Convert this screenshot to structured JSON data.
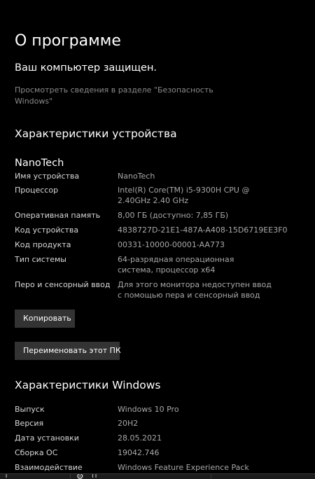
{
  "header": {
    "title": "О программе"
  },
  "status": {
    "protected": "Ваш компьютер защищен.",
    "security_link": "Просмотреть сведения в разделе \"Безопасность Windows\""
  },
  "device_section": {
    "heading": "Характеристики устройства",
    "device_name": "NanoTech",
    "rows": [
      {
        "label": "Имя устройства",
        "value": "NanoTech"
      },
      {
        "label": "Процессор",
        "value": "Intel(R) Core(TM) i5-9300H CPU @ 2.40GHz   2.40 GHz"
      },
      {
        "label": "Оперативная память",
        "value": "8,00 ГБ (доступно: 7,85 ГБ)"
      },
      {
        "label": "Код устройства",
        "value": "4838727D-21E1-487A-A408-15D6719EE3F0"
      },
      {
        "label": "Код продукта",
        "value": "00331-10000-00001-AA773"
      },
      {
        "label": "Тип системы",
        "value": "64-разрядная операционная система, процессор x64"
      },
      {
        "label": "Перо и сенсорный ввод",
        "value": "Для этого монитора недоступен ввод с помощью пера и сенсорный ввод"
      }
    ],
    "copy_button": "Копировать",
    "rename_button": "Переименовать этот ПК"
  },
  "windows_section": {
    "heading": "Характеристики Windows",
    "rows": [
      {
        "label": "Выпуск",
        "value": "Windows 10 Pro"
      },
      {
        "label": "Версия",
        "value": "20H2"
      },
      {
        "label": "Дата установки",
        "value": "28.05.2021"
      },
      {
        "label": "Сборка ОС",
        "value": "19042.746"
      },
      {
        "label": "Взаимодействие",
        "value": "Windows Feature Experience Pack"
      }
    ]
  },
  "taskbar": {
    "item1": "Т",
    "item2": "П",
    "settings_icon": "gear-icon"
  },
  "colors": {
    "background": "#000000",
    "primary_text": "#ffffff",
    "secondary_text": "#a8a8a8",
    "link_text": "#8a8a8a",
    "button_bg": "#333333"
  }
}
